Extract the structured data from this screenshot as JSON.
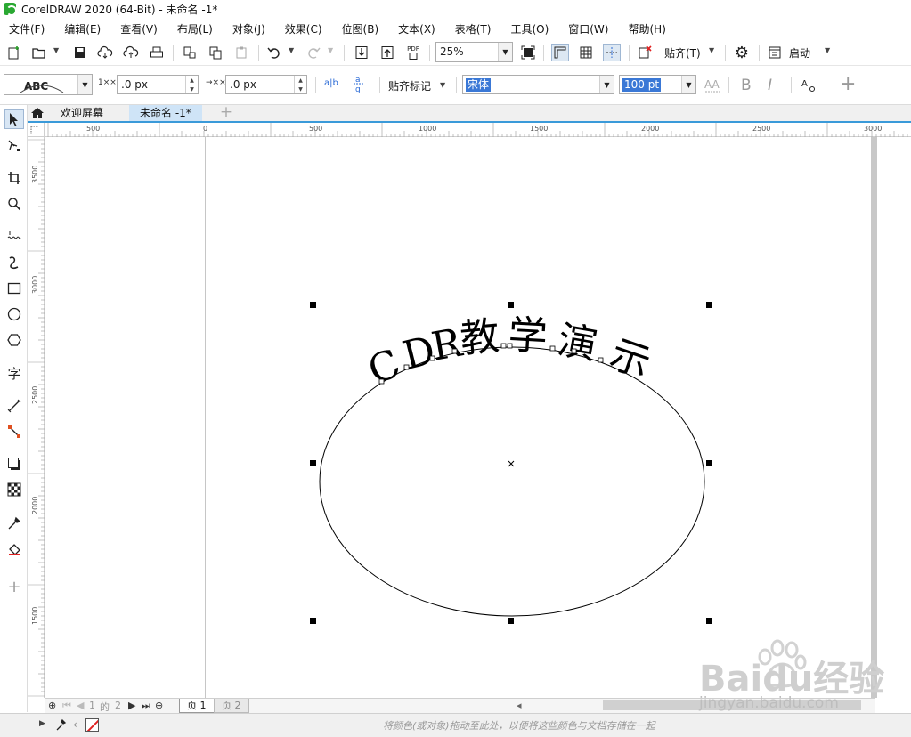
{
  "window": {
    "title": "CorelDRAW 2020 (64-Bit) - 未命名 -1*"
  },
  "menubar": {
    "items": [
      "文件(F)",
      "编辑(E)",
      "查看(V)",
      "布局(L)",
      "对象(J)",
      "效果(C)",
      "位图(B)",
      "文本(X)",
      "表格(T)",
      "工具(O)",
      "窗口(W)",
      "帮助(H)"
    ]
  },
  "toolbar": {
    "zoom_value": "25%",
    "snap_label": "贴齐(T)",
    "launch_label": "启动",
    "pdf_label": "PDF"
  },
  "property_bar": {
    "preset_preview": "ABC",
    "h_offset_icon_label": "1××",
    "h_offset": ".0 px",
    "v_offset_icon_label": "→××",
    "v_offset": ".0 px",
    "snap_marks_label": "贴齐标记",
    "font_name": "宋体",
    "font_size": "100 pt",
    "mirror_h_label": "a|b",
    "bold_label": "B",
    "italic_label": "I"
  },
  "doc_tabs": {
    "welcome": "欢迎屏幕",
    "document": "未命名 -1*"
  },
  "rulers": {
    "horizontal_ticks": [
      "500",
      "0",
      "500",
      "1000",
      "1500",
      "2000",
      "2500",
      "3000"
    ],
    "vertical_ticks": [
      "3500",
      "3000",
      "2500",
      "2000",
      "1500"
    ]
  },
  "canvas": {
    "fitted_text": "CDR教学演示",
    "characters": [
      "C",
      "D",
      "R",
      "教",
      "学",
      "演",
      "示"
    ],
    "stroke_color": "#000000"
  },
  "page_nav": {
    "page_counter_current": "1",
    "page_counter_of": "的",
    "page_counter_total": "2",
    "page_tabs": [
      "页 1",
      "页 2"
    ]
  },
  "statusbar": {
    "hint": "将颜色(或对象)拖动至此处，以便将这些颜色与文档存储在一起"
  },
  "watermark": {
    "brand": "Baidu经验",
    "url": "jingyan.baidu.com"
  },
  "colors": {
    "accent": "#3a9ad9",
    "selection": "#3a78d6",
    "no_fill_slash": "#e02020"
  }
}
